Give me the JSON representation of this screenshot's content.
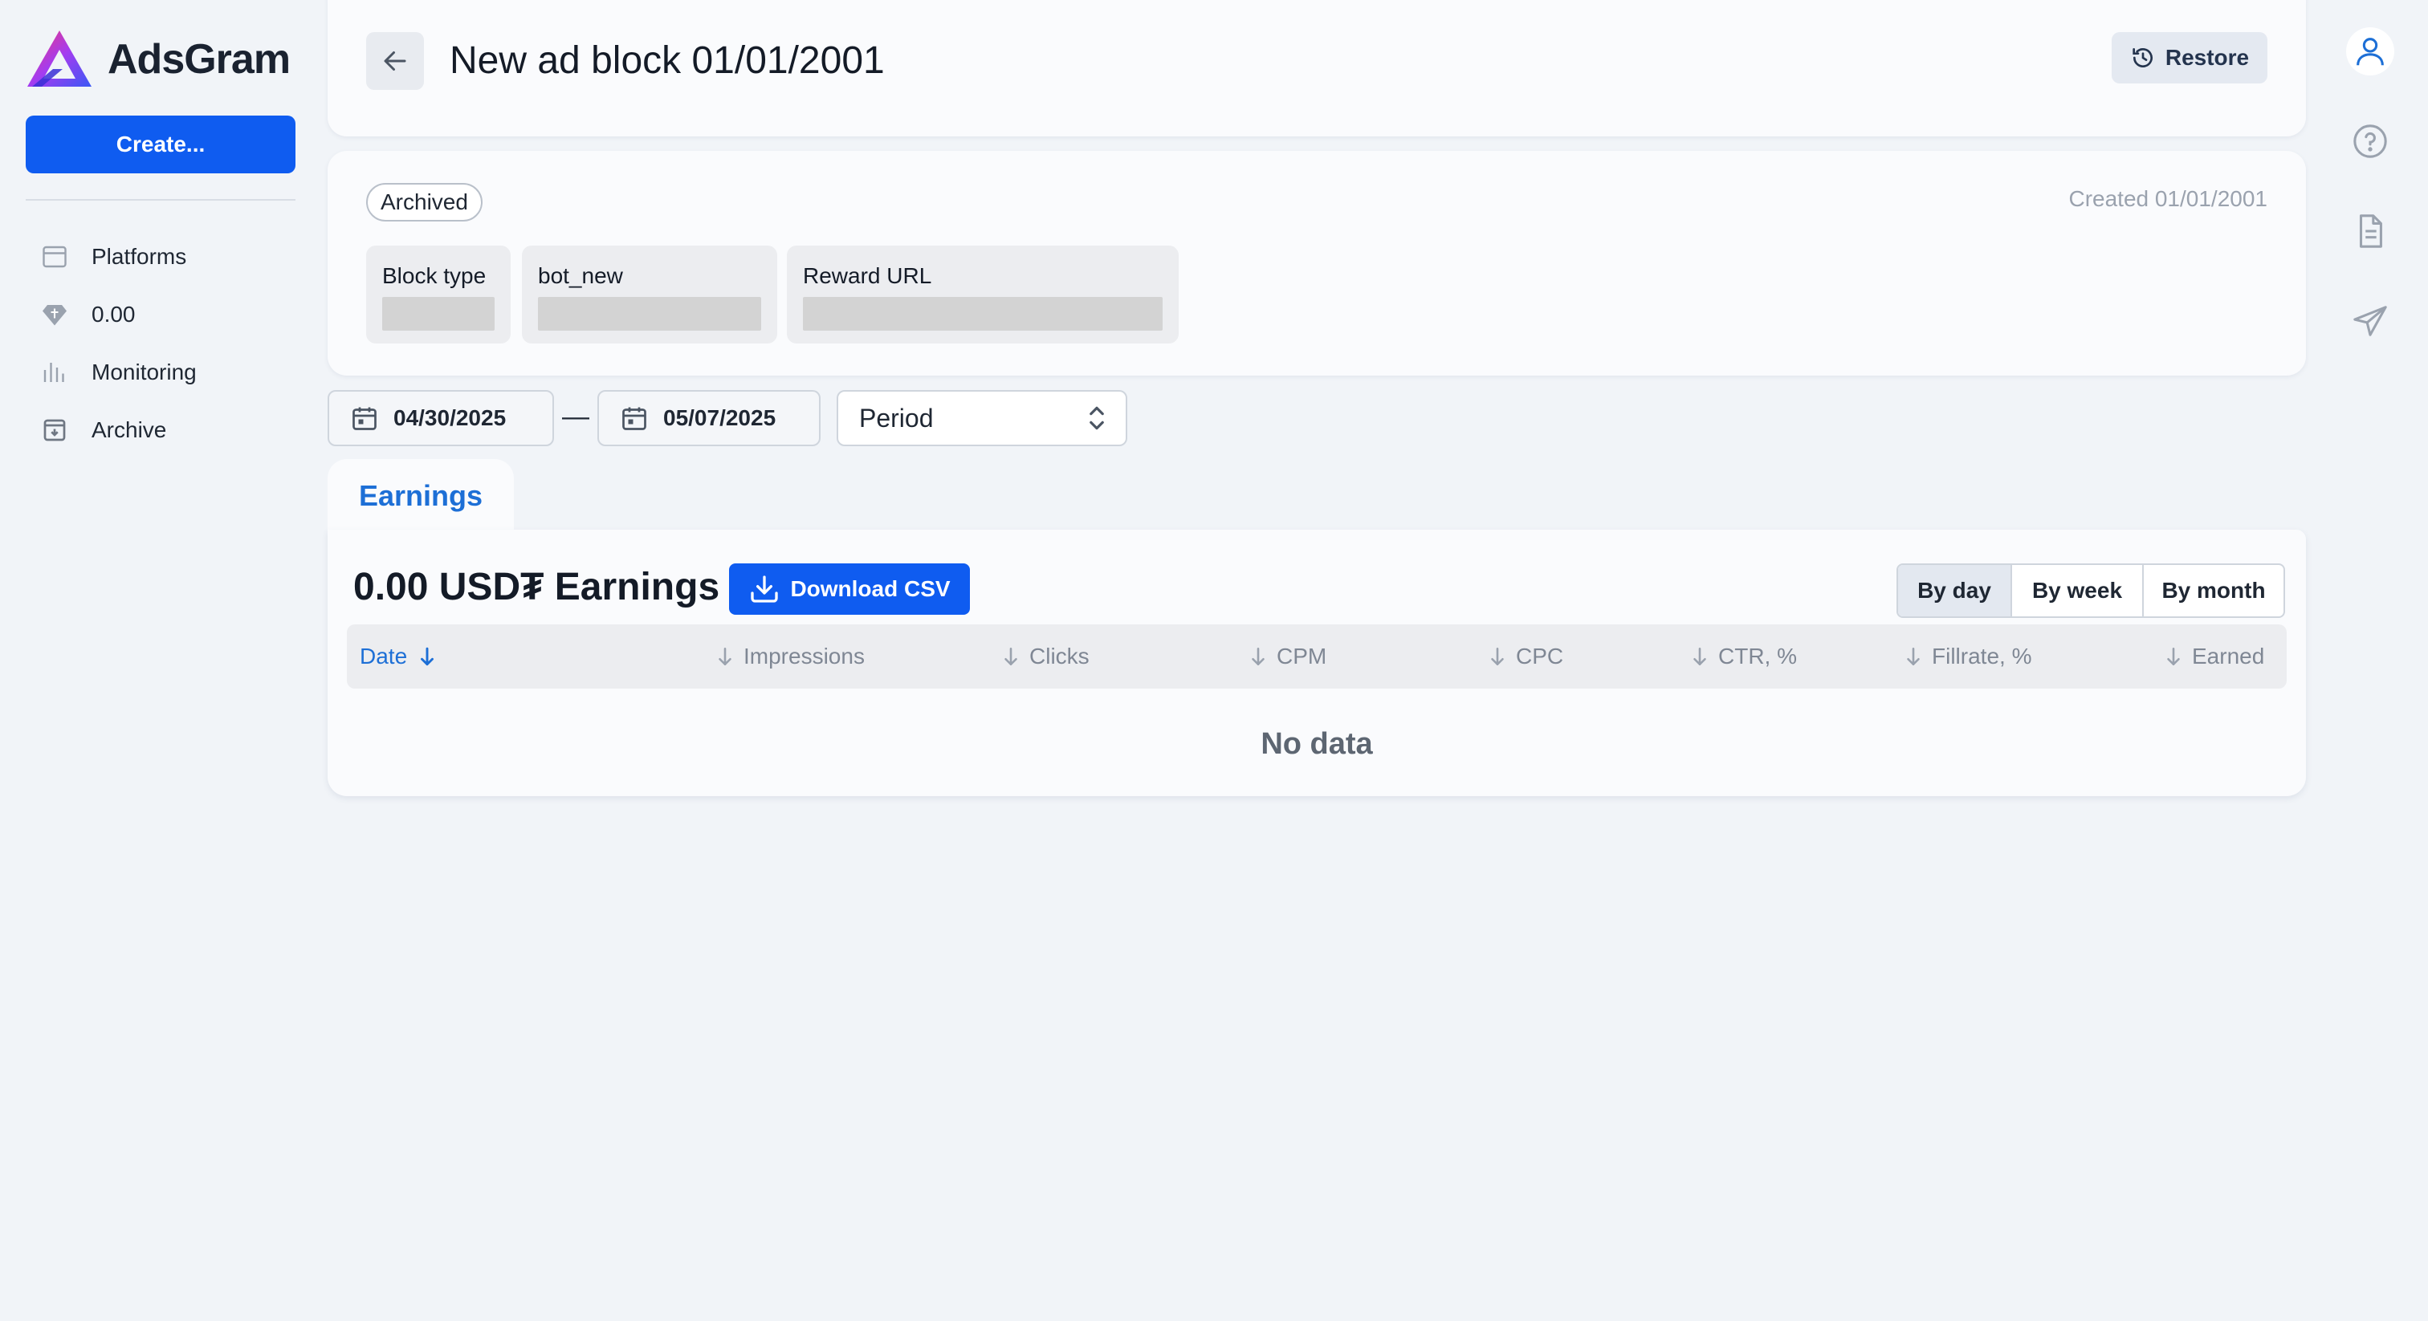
{
  "app": {
    "name": "AdsGram",
    "create_label": "Create..."
  },
  "sidebar": {
    "items": [
      {
        "label": "Platforms",
        "icon": "calendar-icon"
      },
      {
        "label": "0.00",
        "icon": "diamond-icon"
      },
      {
        "label": "Monitoring",
        "icon": "bar-chart-icon"
      },
      {
        "label": "Archive",
        "icon": "archive-icon"
      }
    ]
  },
  "header": {
    "title": "New ad block 01/01/2001",
    "restore_label": "Restore"
  },
  "info": {
    "status": "Archived",
    "created": "Created 01/01/2001",
    "fields": [
      {
        "label": "Block type"
      },
      {
        "label": "bot_new"
      },
      {
        "label": "Reward URL"
      }
    ]
  },
  "filters": {
    "date_from": "04/30/2025",
    "separator": "—",
    "date_to": "05/07/2025",
    "period_placeholder": "Period"
  },
  "tabs": [
    {
      "label": "Earnings",
      "active": true
    }
  ],
  "earnings": {
    "title": "0.00 USD₮ Earnings",
    "download_label": "Download CSV",
    "group_by": [
      {
        "label": "By day",
        "selected": true
      },
      {
        "label": "By week",
        "selected": false
      },
      {
        "label": "By month",
        "selected": false
      }
    ],
    "columns": [
      "Date",
      "Impressions",
      "Clicks",
      "CPM",
      "CPC",
      "CTR, %",
      "Fillrate, %",
      "Earned"
    ],
    "empty_text": "No data"
  },
  "colors": {
    "primary": "#0f5cf0",
    "link": "#1d6fd6",
    "background": "#f1f4f8"
  }
}
